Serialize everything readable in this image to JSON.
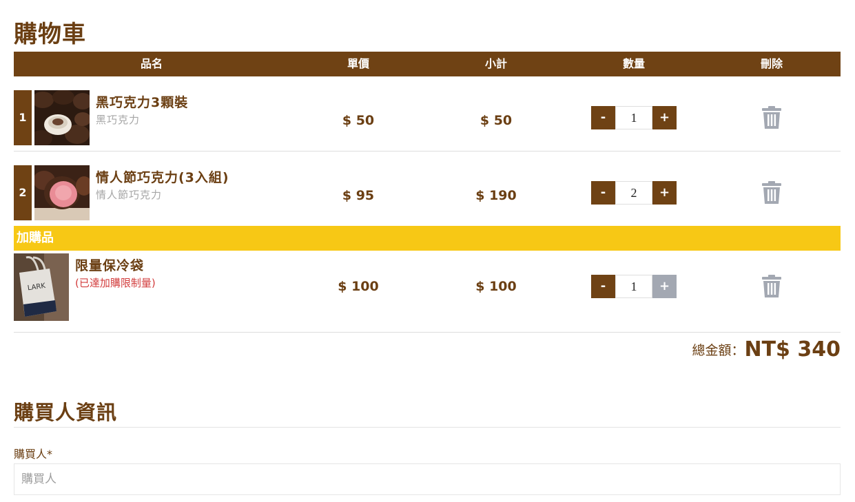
{
  "page_title": "購物車",
  "table_header": {
    "name": "品名",
    "unit_price": "單價",
    "subtotal": "小計",
    "quantity": "數量",
    "delete": "刪除"
  },
  "items": [
    {
      "index": "1",
      "name": "黑巧克力3顆裝",
      "subtitle": "黑巧克力",
      "unit_price": "$ 50",
      "subtotal": "$ 50",
      "quantity": "1",
      "minus": "-",
      "plus": "+"
    },
    {
      "index": "2",
      "name": "情人節巧克力(3入組)",
      "subtitle": "情人節巧克力",
      "unit_price": "$ 95",
      "subtotal": "$ 190",
      "quantity": "2",
      "minus": "-",
      "plus": "+"
    }
  ],
  "addon": {
    "heading": "加購品",
    "item": {
      "name": "限量保冷袋",
      "note": "(已達加購限制量)",
      "unit_price": "$ 100",
      "subtotal": "$ 100",
      "quantity": "1",
      "minus": "-",
      "plus": "+",
      "plus_disabled": true
    }
  },
  "total": {
    "label": "總金額：",
    "value": "NT$ 340"
  },
  "buyer_section": {
    "title": "購買人資訊",
    "buyer_label": "購買人*",
    "buyer_placeholder": "購買人"
  },
  "colors": {
    "brand_brown": "#6f4214",
    "addon_yellow": "#f7c815",
    "disabled_gray": "#a3a8b2",
    "warning_red": "#d23c3c"
  },
  "icons": [
    "trash-icon"
  ]
}
